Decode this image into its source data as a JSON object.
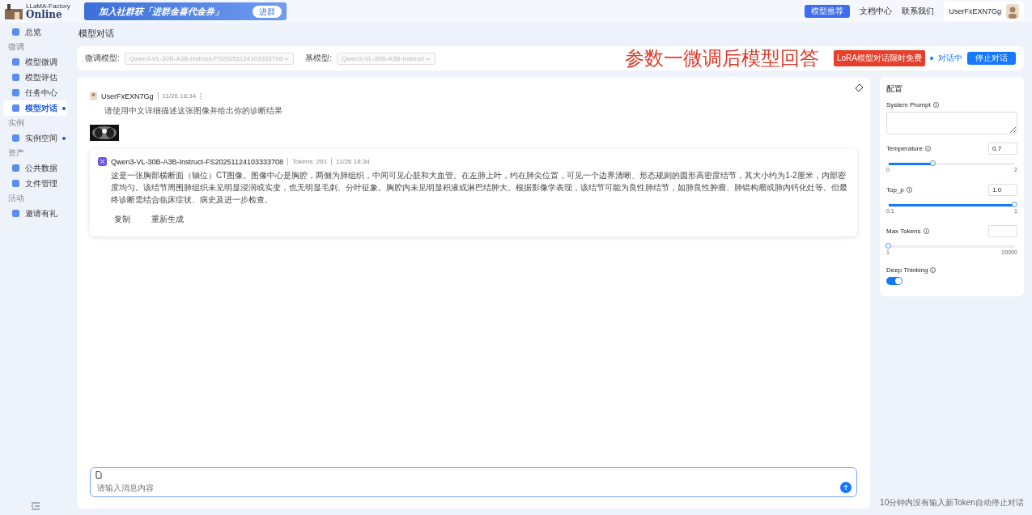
{
  "header": {
    "logo_small": "LLaMA-Factory",
    "logo": "Online",
    "banner": "加入社群获「进群金喜代金券」",
    "banner_button": "进群",
    "recommend": "模型推荐",
    "links": [
      "文档中心",
      "联系我们"
    ],
    "user": "UserFxEXN7Gg"
  },
  "sidebar": [
    {
      "kind": "item",
      "label": "总览",
      "selected": false,
      "dot": false
    },
    {
      "kind": "section",
      "label": "微调"
    },
    {
      "kind": "item",
      "label": "模型微调",
      "selected": false,
      "dot": false
    },
    {
      "kind": "item",
      "label": "模型评估",
      "selected": false,
      "dot": false
    },
    {
      "kind": "item",
      "label": "任务中心",
      "selected": false,
      "dot": false
    },
    {
      "kind": "item",
      "label": "模型对话",
      "selected": true,
      "dot": true
    },
    {
      "kind": "section",
      "label": "实例"
    },
    {
      "kind": "item",
      "label": "实例空间",
      "selected": false,
      "dot": true
    },
    {
      "kind": "section",
      "label": "资产"
    },
    {
      "kind": "item",
      "label": "公共数据",
      "selected": false,
      "dot": false
    },
    {
      "kind": "item",
      "label": "文件管理",
      "selected": false,
      "dot": false
    },
    {
      "kind": "section",
      "label": "活动"
    },
    {
      "kind": "item",
      "label": "邀请有礼",
      "selected": false,
      "dot": false
    }
  ],
  "page_title": "模型对话",
  "toolbar": {
    "finetuned_label": "微调模型:",
    "finetuned_value": "Qwen3-VL-30B-A3B-Instruct-FS20251124103333708",
    "base_label": "基模型:",
    "base_value": "Qwen3-VL-30B-A3B-Instruct",
    "annotation": "参数一微调后模型回答",
    "promo": "LoRA模型对话限时免费",
    "status": "对话中",
    "stop": "停止对话"
  },
  "messages": [
    {
      "kind": "user",
      "author": "UserFxEXN7Gg",
      "time": "11/26 18:34",
      "text": "请使用中文详细描述这张图像并给出你的诊断结果"
    },
    {
      "kind": "assistant",
      "author": "Qwen3-VL-30B-A3B-Instruct-FS20251124103333708",
      "tokens": "Tokens: 261",
      "time": "11/26 18:34",
      "text": "这是一张胸部横断面（轴位）CT图像。图像中心是胸腔，两侧为肺组织，中间可见心脏和大血管。在左肺上叶，约在肺尖位置，可见一个边界清晰、形态规则的圆形高密度结节，其大小约为1-2厘米，内部密度均匀。该结节周围肺组织未见明显浸润或实变，也无明显毛刺、分叶征象。胸腔内未见明显积液或淋巴结肿大。根据影像学表现，该结节可能为良性肺结节，如肺良性肿瘤、肺错构瘤或肺内钙化灶等。但最终诊断需结合临床症状、病史及进一步检查。",
      "actions": [
        "复制",
        "重新生成"
      ]
    }
  ],
  "input": {
    "placeholder": "请输入消息内容"
  },
  "config": {
    "title": "配置",
    "system_prompt": "System Prompt",
    "sliders": [
      {
        "label": "Temperature",
        "value": "0.7",
        "level": 0.35,
        "min": "0",
        "max": "2"
      },
      {
        "label": "Top_p",
        "value": "1.0",
        "level": 1,
        "min": "0.1",
        "max": "1"
      },
      {
        "label": "Max Tokens",
        "level": 0,
        "min": "1",
        "max": "20000"
      }
    ],
    "deep_thinking": {
      "label": "Deep Thinking",
      "on": true
    },
    "footnote": "10分钟内没有输入新Token自动停止对话"
  }
}
